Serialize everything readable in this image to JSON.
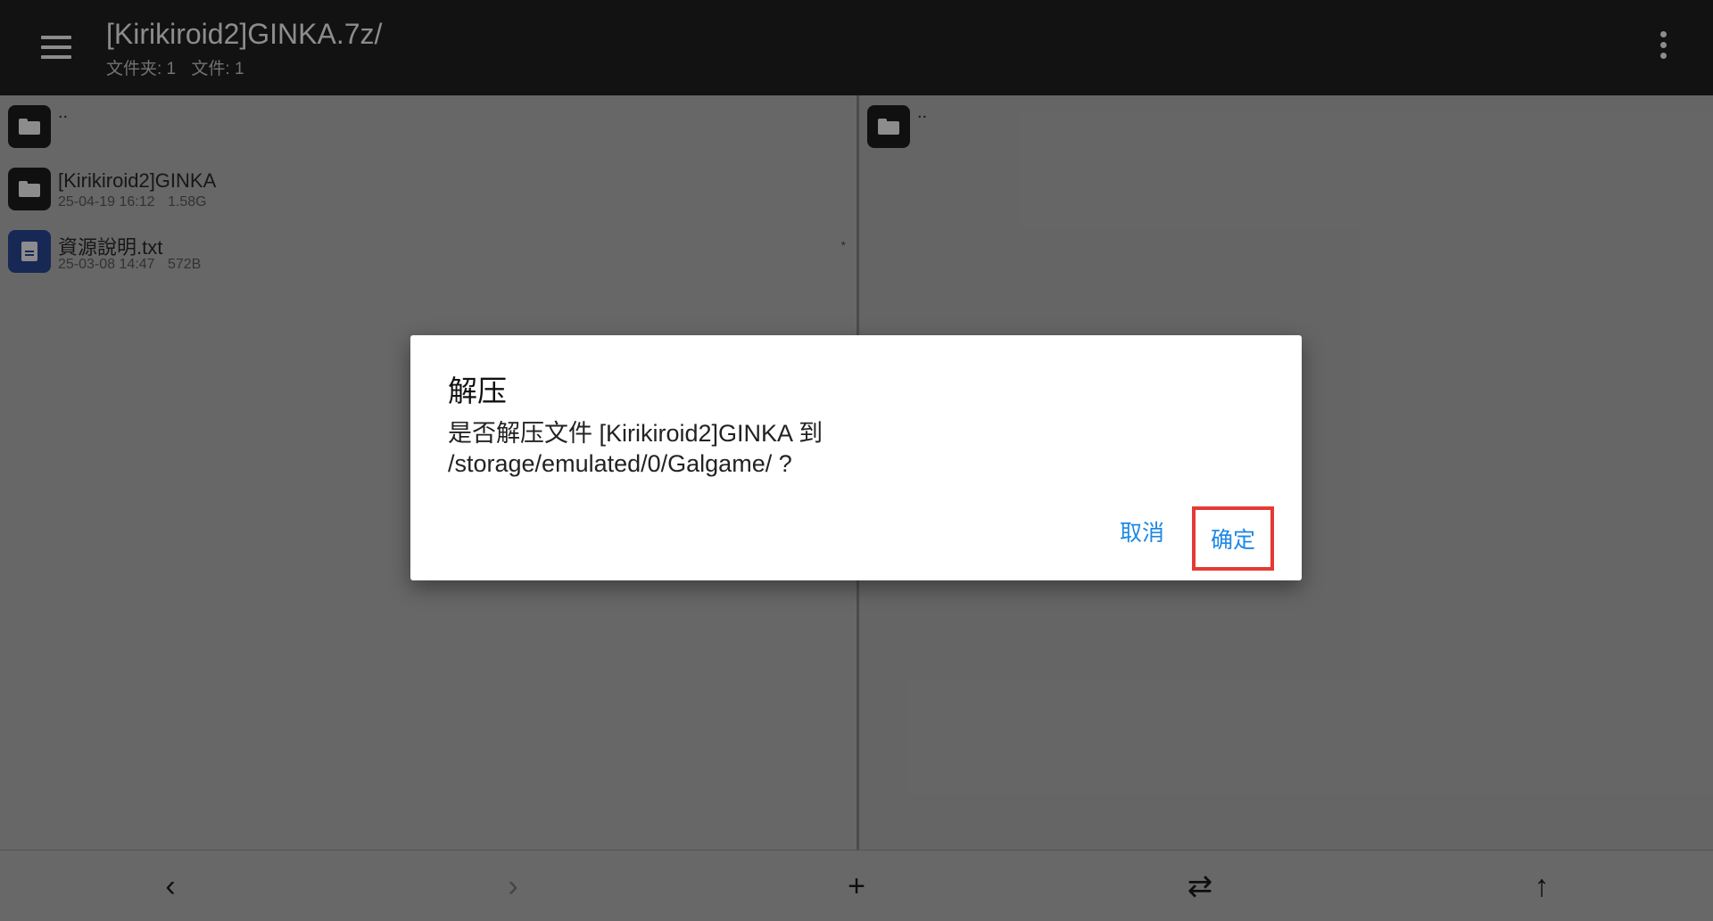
{
  "topbar": {
    "title": "[Kirikiroid2]GINKA.7z/",
    "folders_label": "文件夹: 1",
    "files_label": "文件: 1"
  },
  "left_pane": {
    "parent_label": "..",
    "items": [
      {
        "name": "[Kirikiroid2]GINKA",
        "date": "25-04-19 16:12",
        "size": "1.58G",
        "type": "folder",
        "mark": ""
      },
      {
        "name": "資源說明.txt",
        "date": "25-03-08 14:47",
        "size": "572B",
        "type": "document",
        "mark": "*"
      }
    ]
  },
  "right_pane": {
    "parent_label": ".."
  },
  "dialog": {
    "title": "解压",
    "message_line1": "是否解压文件 [Kirikiroid2]GINKA 到",
    "message_line2": "/storage/emulated/0/Galgame/ ?",
    "cancel_label": "取消",
    "ok_label": "确定"
  },
  "bottombar": {
    "back_icon": "‹",
    "forward_icon": "›",
    "add_icon": "+",
    "swap_icon": "⇄",
    "up_icon": "↑"
  },
  "colors": {
    "accent": "#1e88e5",
    "highlight": "#e53935",
    "topbar": "#212121",
    "doc_icon": "#2b4a9b"
  }
}
